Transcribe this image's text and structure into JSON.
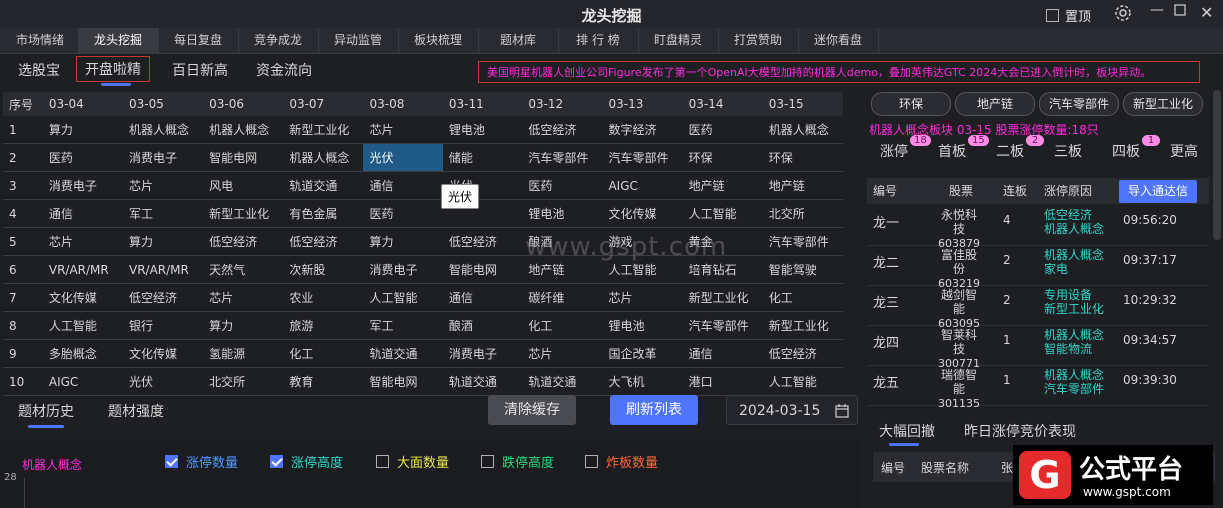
{
  "window": {
    "title": "龙头挖掘",
    "pin_label": "置顶"
  },
  "main_tabs": [
    "市场情绪",
    "龙头挖掘",
    "每日复盘",
    "竞争成龙",
    "异动监管",
    "板块梳理",
    "题材库",
    "排 行 榜",
    "盯盘精灵",
    "打赏赞助",
    "迷你看盘"
  ],
  "sub_tabs": [
    "选股宝",
    "开盘啦精",
    "百日新高",
    "资金流向"
  ],
  "marquee": "美国明星机器人创业公司Figure发布了第一个OpenAI大模型加持的机器人demo，叠加英伟达GTC 2024大会已进入倒计时，板块异动。",
  "grid": {
    "headers": [
      "序号",
      "03-04",
      "03-05",
      "03-06",
      "03-07",
      "03-08",
      "03-11",
      "03-12",
      "03-13",
      "03-14",
      "03-15"
    ],
    "rows": [
      [
        "1",
        "算力",
        "机器人概念",
        "机器人概念",
        "新型工业化",
        "芯片",
        "锂电池",
        "低空经济",
        "数字经济",
        "医药",
        "机器人概念"
      ],
      [
        "2",
        "医药",
        "消费电子",
        "智能电网",
        "机器人概念",
        "光伏",
        "储能",
        "汽车零部件",
        "汽车零部件",
        "环保",
        "环保"
      ],
      [
        "3",
        "消费电子",
        "芯片",
        "风电",
        "轨道交通",
        "通信",
        "光伏",
        "医药",
        "AIGC",
        "地产链",
        "地产链"
      ],
      [
        "4",
        "通信",
        "军工",
        "新型工业化",
        "有色金属",
        "医药",
        "",
        "锂电池",
        "文化传媒",
        "人工智能",
        "北交所"
      ],
      [
        "5",
        "芯片",
        "算力",
        "低空经济",
        "低空经济",
        "算力",
        "低空经济",
        "酿酒",
        "游戏",
        "黄金",
        "汽车零部件"
      ],
      [
        "6",
        "VR/AR/MR",
        "VR/AR/MR",
        "天然气",
        "次新股",
        "消费电子",
        "智能电网",
        "地产链",
        "人工智能",
        "培育钻石",
        "智能驾驶"
      ],
      [
        "7",
        "文化传媒",
        "低空经济",
        "芯片",
        "农业",
        "人工智能",
        "通信",
        "碳纤维",
        "芯片",
        "新型工业化",
        "化工"
      ],
      [
        "8",
        "人工智能",
        "银行",
        "算力",
        "旅游",
        "军工",
        "酿酒",
        "化工",
        "锂电池",
        "汽车零部件",
        "新型工业化"
      ],
      [
        "9",
        "多胎概念",
        "文化传媒",
        "氢能源",
        "化工",
        "轨道交通",
        "消费电子",
        "芯片",
        "国企改革",
        "通信",
        "低空经济"
      ],
      [
        "10",
        "AIGC",
        "光伏",
        "北交所",
        "教育",
        "智能电网",
        "轨道交通",
        "轨道交通",
        "大飞机",
        "港口",
        "人工智能"
      ]
    ],
    "tooltip": "光伏"
  },
  "watermark": "www.gspt.com",
  "bottom": {
    "tabs": [
      "题材历史",
      "题材强度"
    ],
    "clear_button": "清除缓存",
    "refresh_button": "刷新列表",
    "date": "2024-03-15",
    "series_label": "机器人概念",
    "y_tick": "28",
    "legend": [
      {
        "label": "涨停数量",
        "checked": true,
        "color": "#4f9cff"
      },
      {
        "label": "涨停高度",
        "checked": true,
        "color": "#2ed6c9"
      },
      {
        "label": "大面数量",
        "checked": false,
        "color": "#e8e84a"
      },
      {
        "label": "跌停高度",
        "checked": false,
        "color": "#2ed67b"
      },
      {
        "label": "炸板数量",
        "checked": false,
        "color": "#ff6a3a"
      }
    ]
  },
  "right": {
    "tag_buttons": [
      "环保",
      "地产链",
      "汽车零部件",
      "新型工业化"
    ],
    "info": "机器人概念板块 03-15  股票涨停数量:18只",
    "board_tabs": [
      {
        "label": "涨停",
        "badge": "18"
      },
      {
        "label": "首板",
        "badge": "15"
      },
      {
        "label": "二板",
        "badge": "2"
      },
      {
        "label": "三板",
        "badge": ""
      },
      {
        "label": "四板",
        "badge": "1"
      },
      {
        "label": "更高",
        "badge": ""
      }
    ],
    "list_headers": [
      "编号",
      "股票",
      "连板",
      "涨停原因"
    ],
    "import_button": "导入通达信",
    "rows": [
      {
        "rank": "龙一",
        "name": "永悦科技",
        "code": "603879",
        "count": "4",
        "reason1": "低空经济",
        "reason2": "机器人概念",
        "time": "09:56:20"
      },
      {
        "rank": "龙二",
        "name": "富佳股份",
        "code": "603219",
        "count": "2",
        "reason1": "机器人概念",
        "reason2": "家电",
        "time": "09:37:17"
      },
      {
        "rank": "龙三",
        "name": "越剑智能",
        "code": "603095",
        "count": "2",
        "reason1": "专用设备",
        "reason2": "新型工业化",
        "time": "10:29:32"
      },
      {
        "rank": "龙四",
        "name": "智莱科技",
        "code": "300771",
        "count": "1",
        "reason1": "机器人概念",
        "reason2": "智能物流",
        "time": "09:34:57"
      },
      {
        "rank": "龙五",
        "name": "瑞德智能",
        "code": "301135",
        "count": "1",
        "reason1": "机器人概念",
        "reason2": "汽车零部件",
        "time": "09:39:30"
      }
    ],
    "bottom_tabs": [
      "大幅回撤",
      "昨日涨停竞价表现"
    ],
    "bottom_headers": [
      "编号",
      "股票名称",
      "张"
    ]
  },
  "logo": {
    "main": "公式平台",
    "url": "www.gspt.com",
    "glyph": "G"
  }
}
